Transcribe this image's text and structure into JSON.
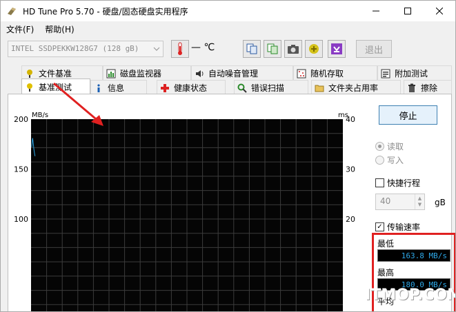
{
  "window": {
    "title": "HD Tune Pro 5.70 - 硬盘/固态硬盘实用程序",
    "controls": [
      "minimize",
      "maximize",
      "close"
    ]
  },
  "menu": {
    "items": [
      "文件(F)",
      "帮助(H)"
    ]
  },
  "toolbar": {
    "drive": "INTEL SSDPEKKW128G7 (128 gB)",
    "temperature": "— ℃",
    "exit_label": "退出",
    "icons": [
      "thermometer-icon",
      "copy-info-icon",
      "copy-screen-icon",
      "camera-icon",
      "options-icon",
      "save-icon"
    ]
  },
  "tabs": {
    "row1": [
      {
        "label": "文件基准",
        "icon": "file-benchmark-icon"
      },
      {
        "label": "磁盘监视器",
        "icon": "disk-monitor-icon"
      },
      {
        "label": "自动噪音管理",
        "icon": "speaker-icon"
      },
      {
        "label": "随机存取",
        "icon": "random-access-icon"
      },
      {
        "label": "附加测试",
        "icon": "extra-tests-icon"
      }
    ],
    "row2": [
      {
        "label": "基准测试",
        "icon": "benchmark-icon",
        "active": true
      },
      {
        "label": "信息",
        "icon": "info-icon"
      },
      {
        "label": "健康状态",
        "icon": "health-icon"
      },
      {
        "label": "错误扫描",
        "icon": "error-scan-icon"
      },
      {
        "label": "文件夹占用率",
        "icon": "folder-usage-icon"
      },
      {
        "label": "擦除",
        "icon": "erase-icon"
      }
    ]
  },
  "chart": {
    "left_unit": "MB/s",
    "right_unit": "ms",
    "left_ticks": [
      "200",
      "150",
      "100"
    ],
    "right_ticks": [
      "40",
      "30",
      "20"
    ],
    "grid_color": "#3c3c3c",
    "trace_color": "#2ea8e8"
  },
  "chart_data": {
    "type": "line",
    "series": [
      {
        "x": [
          0,
          0.3,
          0.6,
          1.0,
          1.4,
          1.8,
          2.2
        ],
        "values": [
          172,
          178,
          181,
          176,
          170,
          166,
          163
        ]
      }
    ],
    "ylim": [
      0,
      200
    ],
    "y2lim": [
      0,
      40
    ],
    "grid": true
  },
  "controls": {
    "stop_label": "停止",
    "read_label": "读取",
    "write_label": "写入",
    "quick_label": "快捷行程",
    "quick_value": "40",
    "quick_unit": "gB",
    "transfer_label": "传输速率",
    "min_label": "最低",
    "min_value": "163.8 MB/s",
    "max_label": "最高",
    "max_value": "180.0 MB/s",
    "avg_label": "平均"
  },
  "watermark": "ITMOP.COM"
}
